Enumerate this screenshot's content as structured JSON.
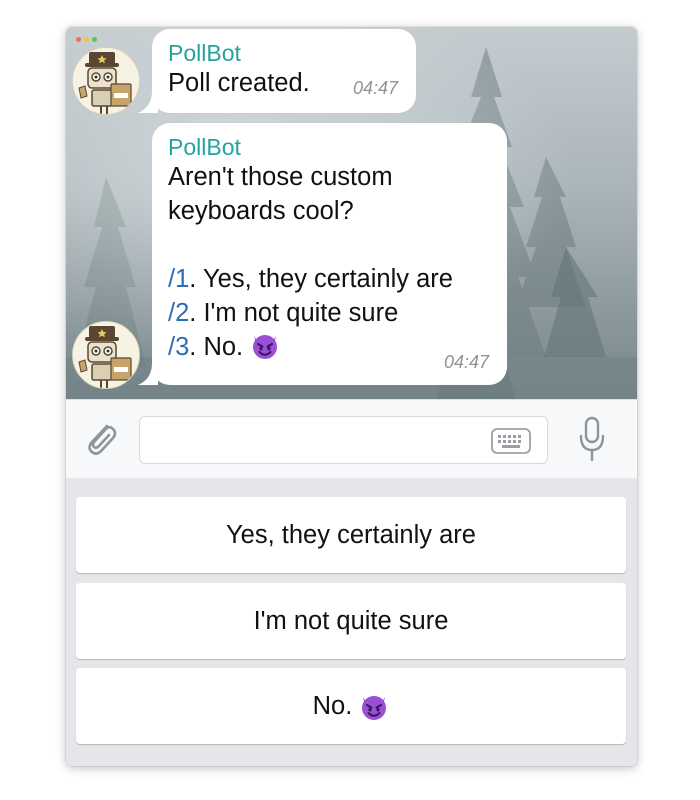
{
  "colors": {
    "sender": "#25a3a0",
    "command": "#2a6fb5",
    "timestamp": "#8e9398",
    "keyboard_bg": "#e4e6ea",
    "traffic_lights": [
      "#f26b5b",
      "#f6c244",
      "#5fc454"
    ]
  },
  "chat": {
    "messages": [
      {
        "sender": "PollBot",
        "text": "Poll created.",
        "time": "04:47"
      },
      {
        "sender": "PollBot",
        "question": "Aren't those custom\nkeyboards cool?",
        "options": [
          {
            "command": "/1",
            "label": ". Yes, they certainly are"
          },
          {
            "command": "/2",
            "label": ". I'm not quite sure"
          },
          {
            "command": "/3",
            "label": ". No."
          }
        ],
        "option3_emoji": "smiling-devil-emoji",
        "time": "04:47"
      }
    ],
    "avatar_icon": "pollbot-robot-avatar"
  },
  "input_bar": {
    "attach_icon": "paperclip-icon",
    "keyboard_icon": "keyboard-icon",
    "mic_icon": "microphone-icon",
    "placeholder": ""
  },
  "reply_keyboard": {
    "buttons": [
      {
        "label": "Yes, they certainly are"
      },
      {
        "label": "I'm not quite sure"
      },
      {
        "label": "No.",
        "emoji": "smiling-devil-emoji"
      }
    ]
  }
}
